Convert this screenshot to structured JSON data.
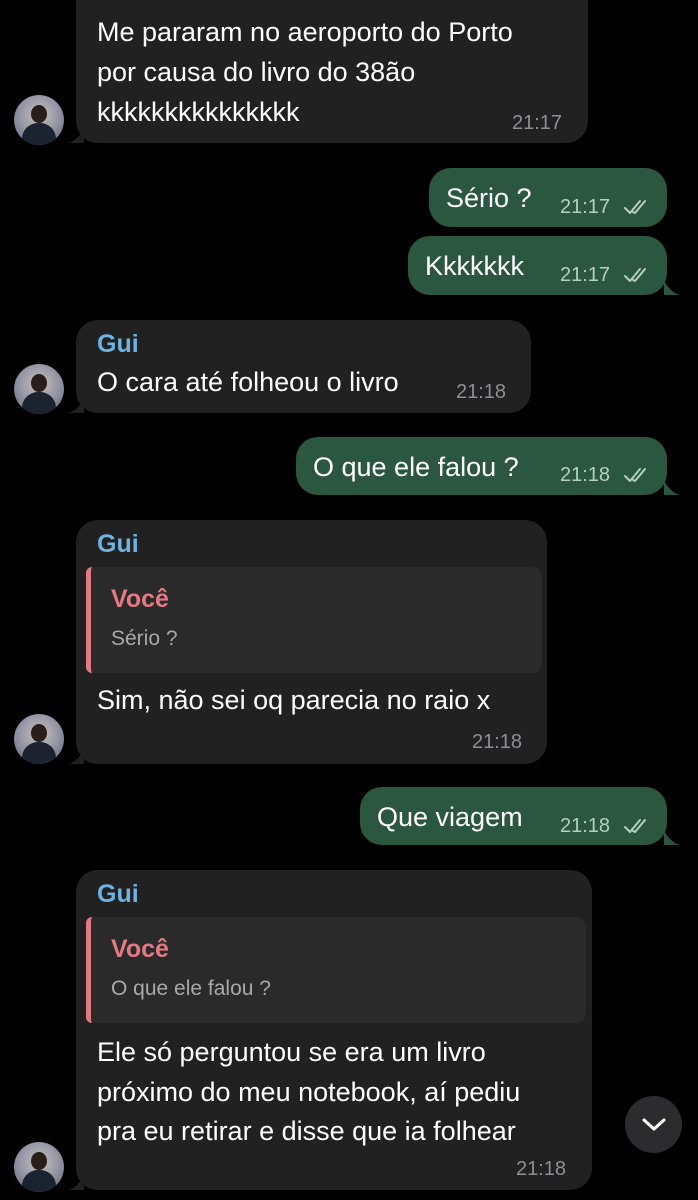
{
  "contact": {
    "name": "Gui"
  },
  "reply_label": "Você",
  "messages": [
    {
      "dir": "in",
      "lines": [
        "Me pararam no aeroporto do Porto",
        "por causa do livro do 38ão",
        "kkkkkkkkkkkkkkk"
      ],
      "time": "21:17"
    },
    {
      "dir": "out",
      "text": "Sério ?",
      "time": "21:17"
    },
    {
      "dir": "out",
      "text": "Kkkkkkk",
      "time": "21:17"
    },
    {
      "dir": "in",
      "sender": "Gui",
      "text": "O cara até folheou o livro",
      "time": "21:18"
    },
    {
      "dir": "out",
      "text": "O que ele falou ?",
      "time": "21:18"
    },
    {
      "dir": "in",
      "sender": "Gui",
      "reply_to": {
        "name": "Você",
        "text": "Sério ?"
      },
      "text": "Sim, não sei oq parecia no raio x",
      "time": "21:18"
    },
    {
      "dir": "out",
      "text": "Que viagem",
      "time": "21:18"
    },
    {
      "dir": "in",
      "sender": "Gui",
      "reply_to": {
        "name": "Você",
        "text": "O que ele falou ?"
      },
      "lines": [
        "Ele só perguntou se era um livro",
        "próximo do meu notebook, aí pediu",
        "pra eu retirar e disse que ia folhear"
      ],
      "time": "21:18"
    }
  ],
  "icons": {
    "read_receipt": "double-check-icon",
    "scroll_down": "chevron-down-icon"
  },
  "colors": {
    "incoming": "#212121",
    "outgoing": "#2b5640",
    "sender": "#6fb1e0",
    "reply_accent": "#e57883"
  }
}
